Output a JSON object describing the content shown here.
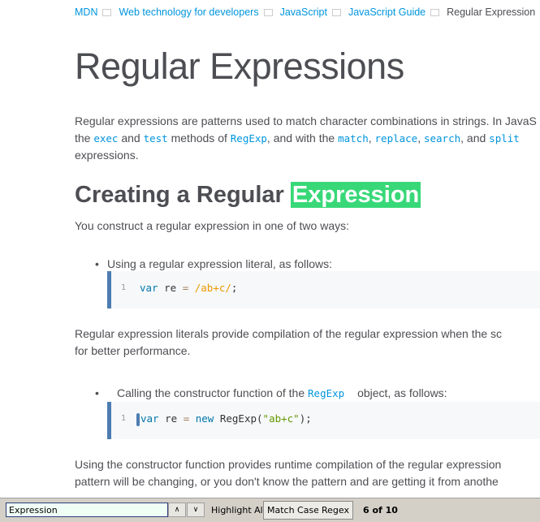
{
  "breadcrumb": [
    "MDN",
    "Web technology for developers",
    "JavaScript",
    "JavaScript Guide",
    "Regular Expression"
  ],
  "title": "Regular Expressions",
  "intro": {
    "p1": "Regular expressions are patterns used to match character combinations in strings. In JavaS",
    "the": "the ",
    "exec": "exec",
    "and1": " and ",
    "test": "test",
    "methods": " methods of ",
    "RegExp": "RegExp",
    "withthe": ", and with the ",
    "match": "match",
    "c1": ", ",
    "replace": "replace",
    "c2": ", ",
    "search": "search",
    "and2": ", and ",
    "split": "split",
    "p3": "expressions."
  },
  "h2": {
    "pre": "Creating a Regular ",
    "highlight": "Expression"
  },
  "construct": "You construct a regular expression in one of two ways:",
  "bullet1": "Using a regular expression literal, as follows:",
  "code1": {
    "line": "1",
    "kw": "var",
    "id": " re ",
    "op": "=",
    "re": " /ab+c/",
    "end": ";"
  },
  "para1a": "Regular expression literals provide compilation of the regular expression when the sc",
  "para1b": "for better performance.",
  "bullet2": {
    "pre": "Calling the constructor function of the ",
    "code": "RegExp",
    "post": " object, as follows:"
  },
  "code2": {
    "line": "1",
    "kw": "var",
    "id": " re ",
    "op": "=",
    "new": "new",
    "call": " RegExp(",
    "str": "\"ab+c\"",
    "end": ");"
  },
  "para2a": "Using the constructor function provides runtime compilation of the regular expression",
  "para2b": "pattern will be changing, or you don't know the pattern and are getting it from anothe",
  "findbar": {
    "value": "Expression",
    "up": "∧",
    "down": "∨",
    "highlight_all": "Highlight All",
    "match_case": "Match Case",
    "regex": "Regex",
    "status": "6 of 10"
  }
}
